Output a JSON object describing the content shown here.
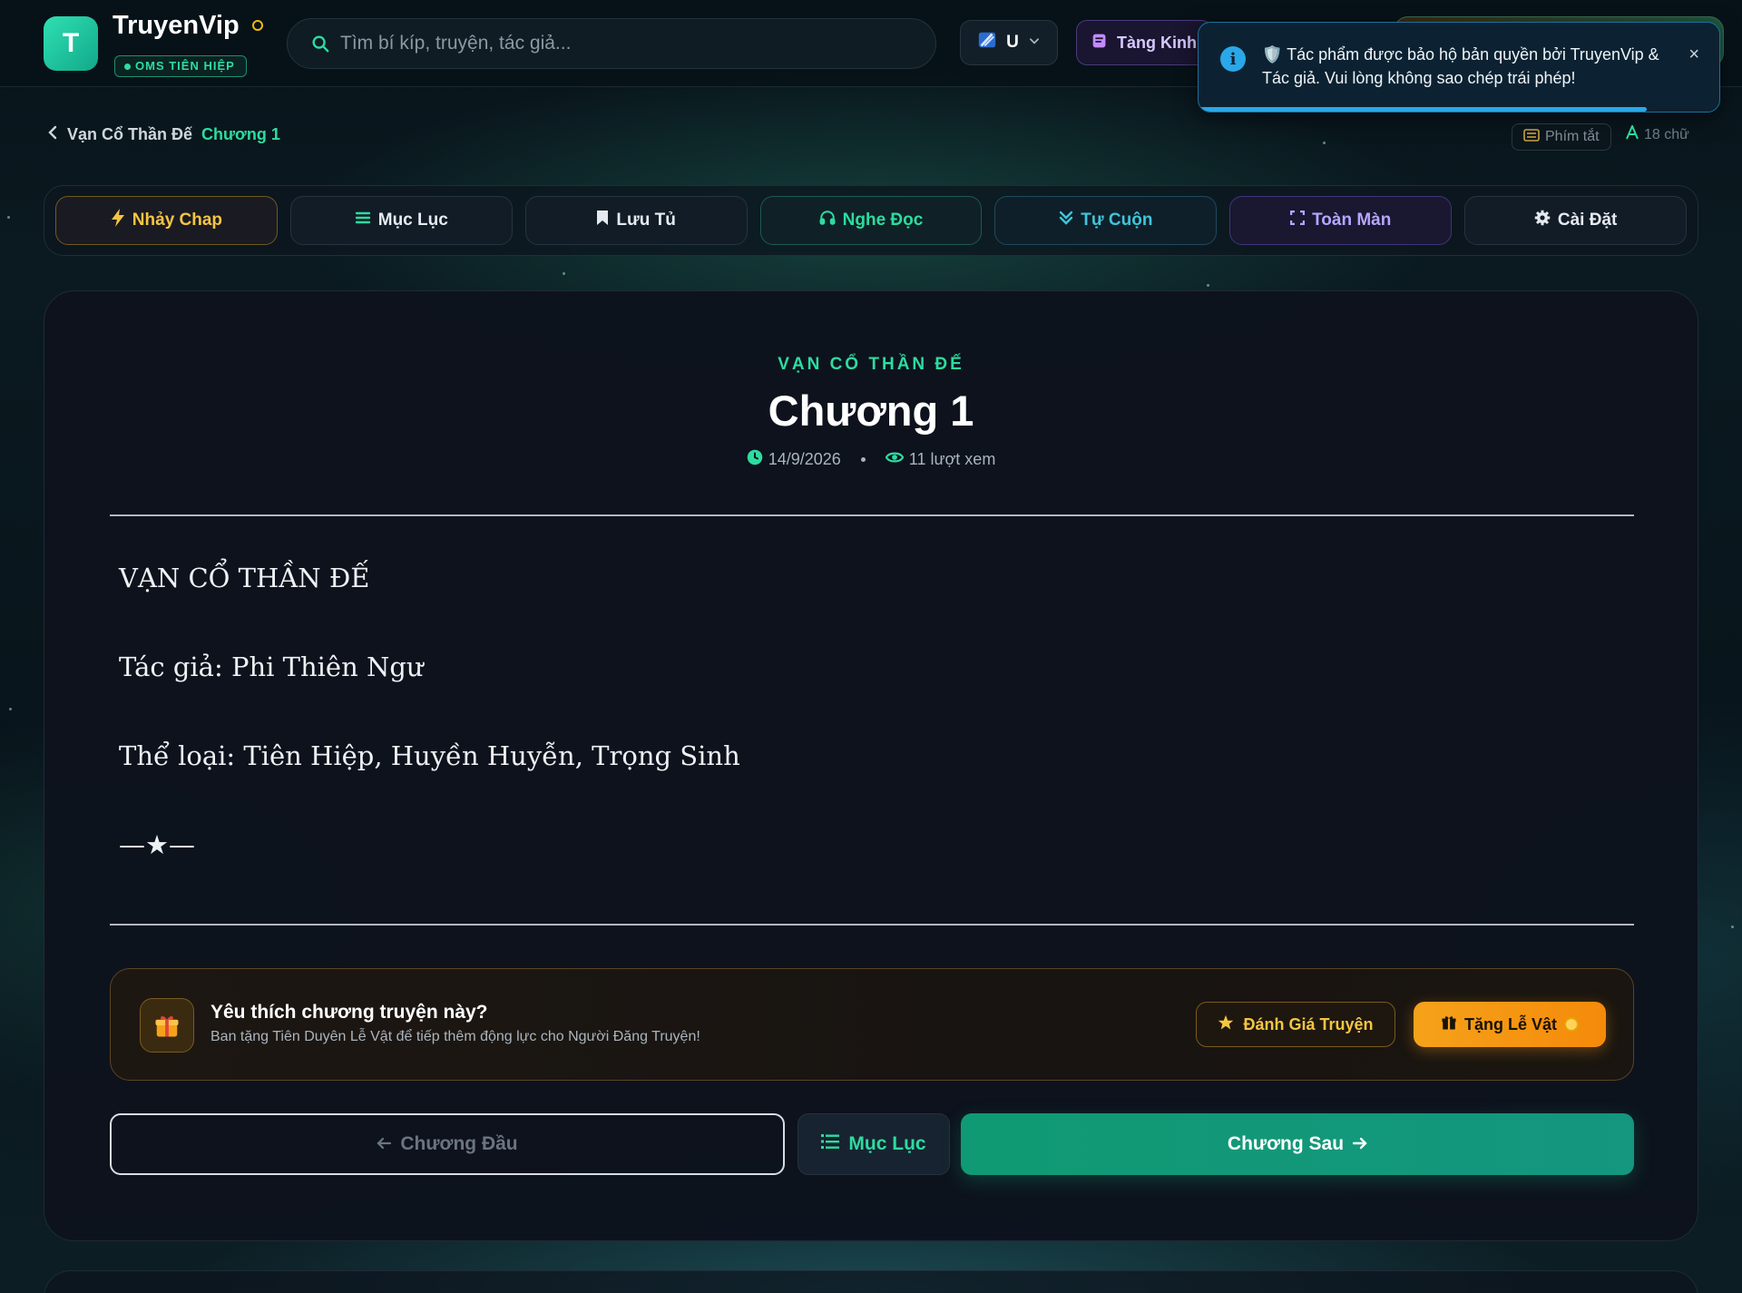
{
  "header": {
    "logo_letter": "T",
    "brand": "TruyenVip",
    "badge": "OMS TIÊN HIỆP",
    "search_placeholder": "Tìm bí kíp, truyện, tác giả...",
    "lang_label": "U",
    "gift_label": "Tàng Kinh"
  },
  "toast": {
    "message": "🛡️ Tác phẩm được bảo hộ bản quyền bởi TruyenVip & Tác giả. Vui lòng không sao chép trái phép!",
    "close": "×",
    "progress": 0.86
  },
  "breadcrumb": {
    "book": "Vạn Cổ Thần Đế",
    "chapter": "Chương 1"
  },
  "reader_info": {
    "shortcut_label": "Phím tắt",
    "word_count": "18 chữ"
  },
  "toolbar": {
    "jump": "Nhảy Chap",
    "toc": "Mục Lục",
    "save": "Lưu Tủ",
    "listen": "Nghe Đọc",
    "autoscroll": "Tự Cuộn",
    "fullscreen": "Toàn Màn",
    "settings": "Cài Đặt"
  },
  "chapter": {
    "novel_name": "VẠN CỔ THẦN ĐẾ",
    "title": "Chương 1",
    "date": "14/9/2026",
    "views": "11 lượt xem",
    "paragraphs": [
      "VẠN CỔ THẦN ĐẾ",
      "Tác giả: Phi Thiên Ngư",
      "Thể loại: Tiên Hiệp, Huyền Huyễn, Trọng Sinh",
      "—★—"
    ]
  },
  "support": {
    "title": "Yêu thích chương truyện này?",
    "subtitle": "Ban tặng Tiên Duyên Lễ Vật để tiếp thêm động lực cho Người Đăng Truyện!",
    "rate_label": "Đánh Giá Truyện",
    "donate_label": "Tặng Lễ Vật"
  },
  "nav": {
    "prev_label": "Chương Đầu",
    "toc_label": "Mục Lục",
    "next_label": "Chương Sau"
  },
  "colors": {
    "accent": "#2ddc9f",
    "gold": "#f5c542",
    "orange": "#f5a21a",
    "info": "#2aa7e8"
  }
}
